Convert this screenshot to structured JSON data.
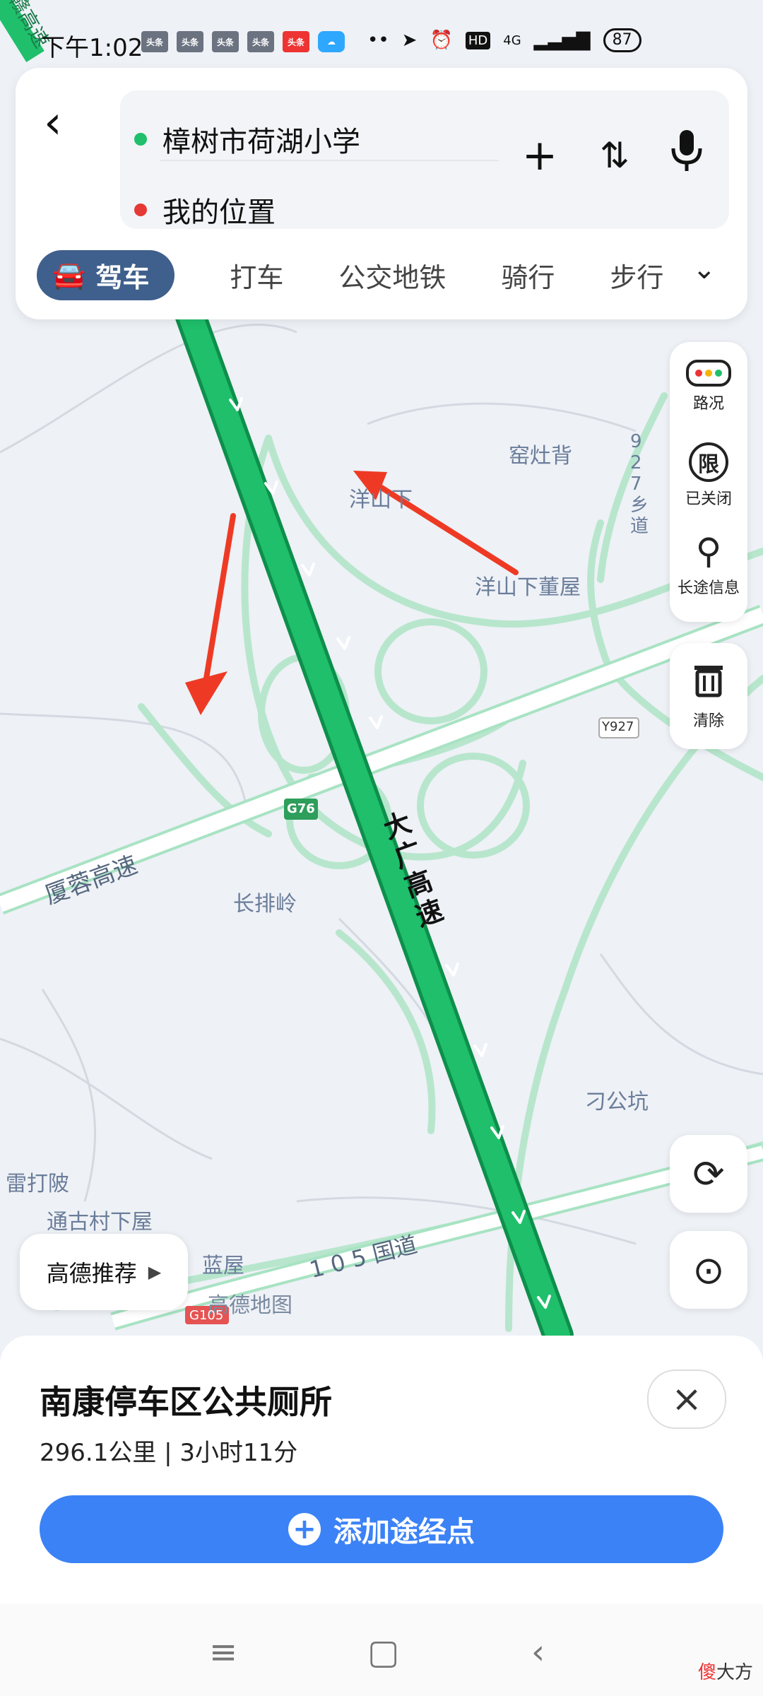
{
  "status_bar": {
    "time": "下午1:02",
    "app_icons": [
      "头条",
      "头条",
      "头条",
      "头条",
      "头条"
    ],
    "network": "4G",
    "hd": "HD",
    "battery": "87"
  },
  "route": {
    "start": "樟树市荷湖小学",
    "end": "我的位置"
  },
  "tabs": [
    {
      "label": "驾车",
      "active": true
    },
    {
      "label": "打车",
      "active": false
    },
    {
      "label": "公交地铁",
      "active": false
    },
    {
      "label": "骑行",
      "active": false
    },
    {
      "label": "步行",
      "active": false
    }
  ],
  "side_panel": {
    "traffic": "路况",
    "restriction_icon_text": "限",
    "restriction": "已关闭",
    "long_trip": "长途信息",
    "clear": "清除"
  },
  "map_labels": {
    "village1": "窑灶背",
    "village2": "洋山下",
    "village3": "洋山下董屋",
    "road_vertical": "9 2 7 乡 道",
    "road_y927": "Y927",
    "road_g76": "G76",
    "highway_xiarong": "厦蓉高速",
    "village4": "长排岭",
    "highway_daguang": "大广高速",
    "village5": "刁公坑",
    "village6": "雷打陂",
    "village7": "通古村下屋",
    "village8": "蓝屋",
    "national_road": "1 0 5 国道",
    "road_g105": "G105",
    "map_brand": "高德地图",
    "top_highway": "赣高速"
  },
  "recommend": "高德推荐",
  "destination": {
    "name": "南康停车区公共厕所",
    "meta": "296.1公里 | 3小时11分"
  },
  "add_waypoint": "添加途经点",
  "watermark": {
    "red": "傻",
    "rest": "大方"
  },
  "colors": {
    "route_green": "#1fbf6b",
    "road_light": "#a8e3c3",
    "accent_blue": "#3b82f6",
    "arrow_red": "#ee3a24"
  }
}
